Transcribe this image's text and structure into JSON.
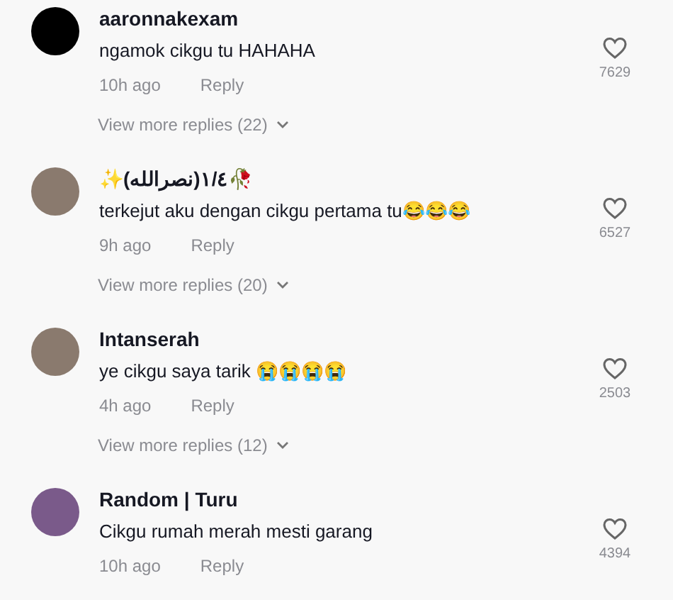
{
  "comments": [
    {
      "username": "aaronnakexam",
      "text": "ngamok cikgu tu HAHAHA",
      "time": "10h ago",
      "reply": "Reply",
      "likes": "7629",
      "kind": "dark",
      "view_more": "View more replies (22)"
    },
    {
      "username": "✨(نصرالله)١/٤🥀",
      "text": "terkejut aku dengan cikgu pertama tu😂😂😂",
      "time": "9h ago",
      "reply": "Reply",
      "likes": "6527",
      "kind": "photo",
      "view_more": "View more replies (20)"
    },
    {
      "username": "Intanserah",
      "text": "ye cikgu saya tarik 😭😭😭😭",
      "time": "4h ago",
      "reply": "Reply",
      "likes": "2503",
      "kind": "photo",
      "view_more": "View more replies (12)"
    },
    {
      "username": "Random | Turu",
      "text": "Cikgu rumah merah mesti garang",
      "time": "10h ago",
      "reply": "Reply",
      "likes": "4394",
      "kind": "cartoon"
    }
  ]
}
